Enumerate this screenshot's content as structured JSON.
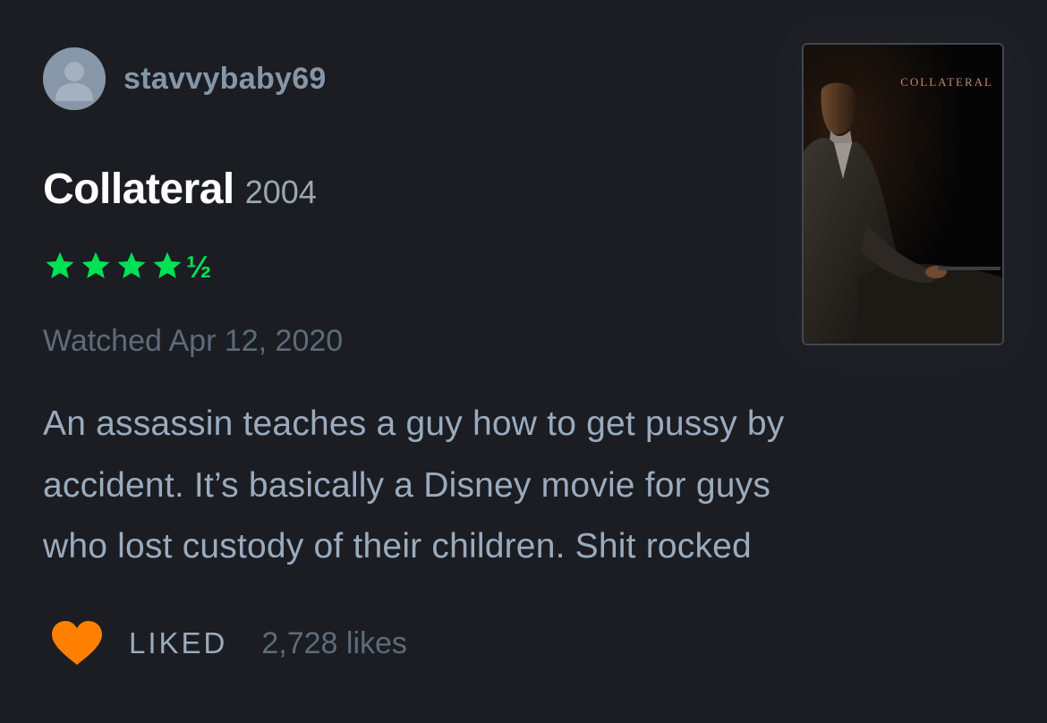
{
  "user": {
    "username": "stavvybaby69",
    "avatar_icon": "default-person-icon"
  },
  "film": {
    "title": "Collateral",
    "year": "2004",
    "poster_title": "COLLATERAL"
  },
  "rating": {
    "stars": 4.5,
    "full_stars": 4,
    "half_glyph": "½",
    "color": "#00e054"
  },
  "watched": "Watched Apr 12, 2020",
  "review": {
    "lines": [
      "An assassin teaches a guy how to get pussy by",
      "accident. It’s basically a Disney movie for guys",
      "who lost custody of their children. Shit rocked"
    ]
  },
  "footer": {
    "heart_icon": "heart-icon",
    "heart_color": "#ff8000",
    "liked_label": "LIKED",
    "likes_count": "2,728 likes"
  }
}
